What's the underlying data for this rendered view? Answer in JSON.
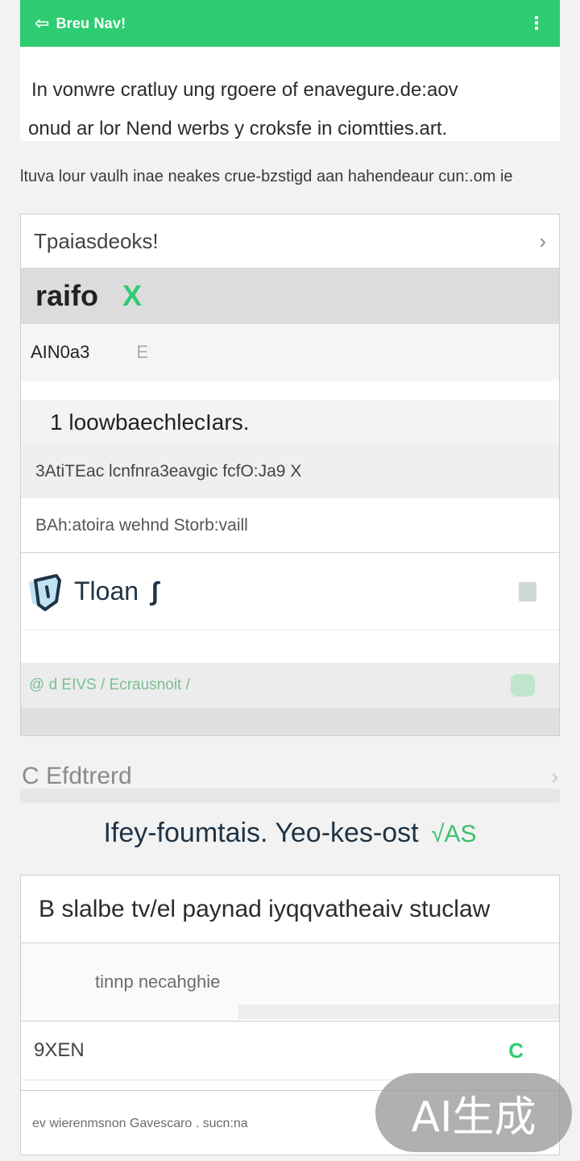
{
  "header": {
    "back_icon": "back-arrow-icon",
    "title": "Breu Nav!",
    "more_icon": "more-icon"
  },
  "intro": {
    "line1": "In vonwre cratluy ung rgoere of enavegure.de:aov",
    "line2": "onud ar lor Nend werbs y croksfe in ciomtties.art."
  },
  "notice": "ltuva lour vaulh inae neakes crue-bzstigd aan hahendeaur cun:.om ie",
  "card1": {
    "section_label": "Tpaiasdeoks!",
    "brand_label": "raifo",
    "brand_mark": "X",
    "code_label": "AIN0a3",
    "code_suffix": "E",
    "description": "1 loowbaechlecIars.",
    "detail": "3AtiTEac lcnfnra3eavgic fcfO:Ja9 X",
    "sub": "BAh:atoira wehnd Storb:vaill",
    "plan_label": "Tloan",
    "plan_icon": "shield-icon",
    "status": "@ d EIVS / Ecrausnoit /"
  },
  "section2": {
    "label": "C Efdtrerd"
  },
  "heading": {
    "text": "Ifey-foumtais. Yeo-kes-ost",
    "accent": "√AS"
  },
  "card2": {
    "input_text": "B slalbe tv/el paynad iyqqvatheaiv stuclaw",
    "hint": "tinnp necahghie",
    "code": "9XEN",
    "code_mark": "C",
    "footer": "ev wierenmsnon Gavescaro . sucn:na"
  },
  "badge": {
    "text": "AI生成"
  },
  "colors": {
    "accent": "#2ecc71",
    "navy": "#1f3344",
    "background": "#f2f2f2"
  }
}
